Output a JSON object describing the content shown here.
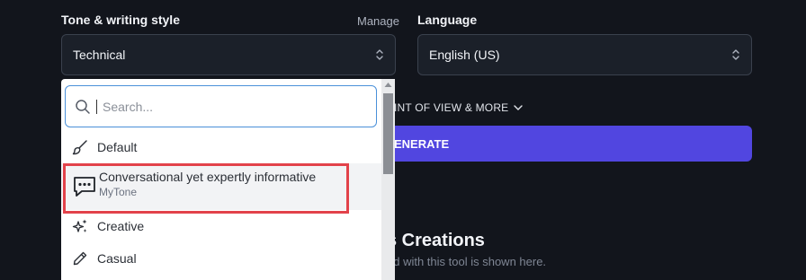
{
  "tone": {
    "label": "Tone & writing style",
    "manage_label": "Manage",
    "selected": "Technical"
  },
  "language": {
    "label": "Language",
    "selected": "English (US)"
  },
  "point_of_view_label": "INT OF VIEW & MORE",
  "generate_label": "ENERATE",
  "creations": {
    "title": "s Creations",
    "subtitle": "ed with this tool is shown here."
  },
  "dropdown": {
    "search_placeholder": "Search...",
    "options": [
      {
        "label": "Default",
        "icon": "brush-icon"
      },
      {
        "label": "Conversational yet expertly informative",
        "sublabel": "MyTone",
        "icon": "chat-bubble-icon",
        "highlighted": true
      },
      {
        "label": "Creative",
        "icon": "sparkles-icon"
      },
      {
        "label": "Casual",
        "icon": "pencil-icon"
      }
    ]
  },
  "colors": {
    "background": "#12151c",
    "accent": "#5146e0",
    "highlight_border": "#e2424a"
  }
}
